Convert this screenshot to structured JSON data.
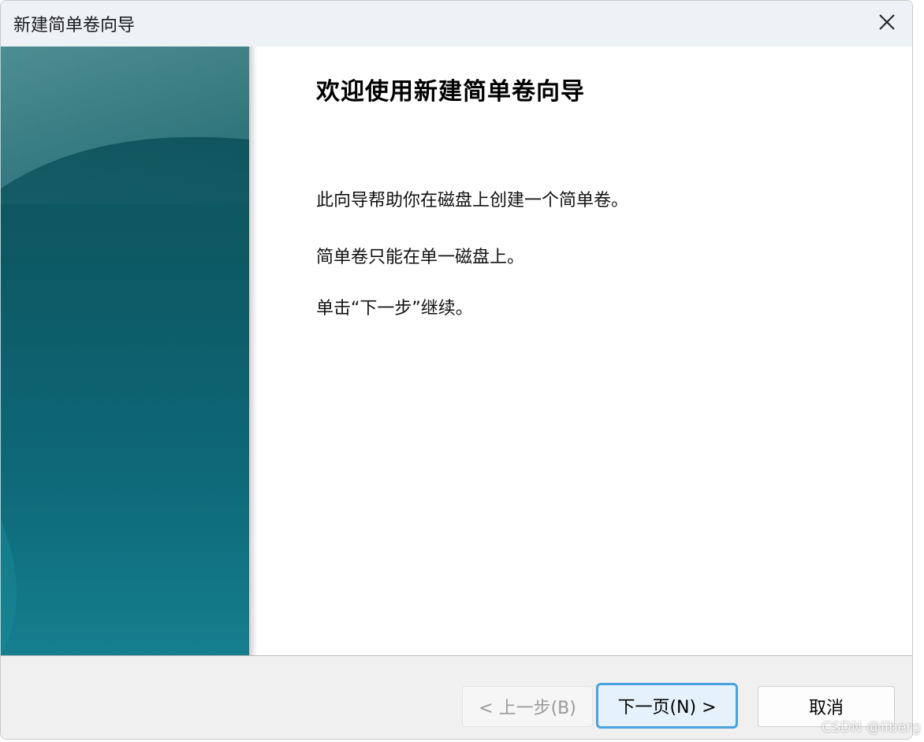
{
  "window": {
    "title": "新建简单卷向导"
  },
  "main": {
    "heading": "欢迎使用新建简单卷向导",
    "paragraphs": [
      "此向导帮助你在磁盘上创建一个简单卷。",
      "简单卷只能在单一磁盘上。",
      "单击“下一步”继续。"
    ]
  },
  "footer": {
    "back_label": "< 上一步(B)",
    "next_label": "下一页(N) >",
    "cancel_label": "取消"
  },
  "watermark": "CSDN @liberg",
  "icons": {
    "close": "close-icon"
  },
  "colors": {
    "sidebar_top": "#3c7f85",
    "sidebar_bottom": "#157f8f",
    "next_border": "#4aa3df",
    "titlebar": "#eef2f7"
  }
}
